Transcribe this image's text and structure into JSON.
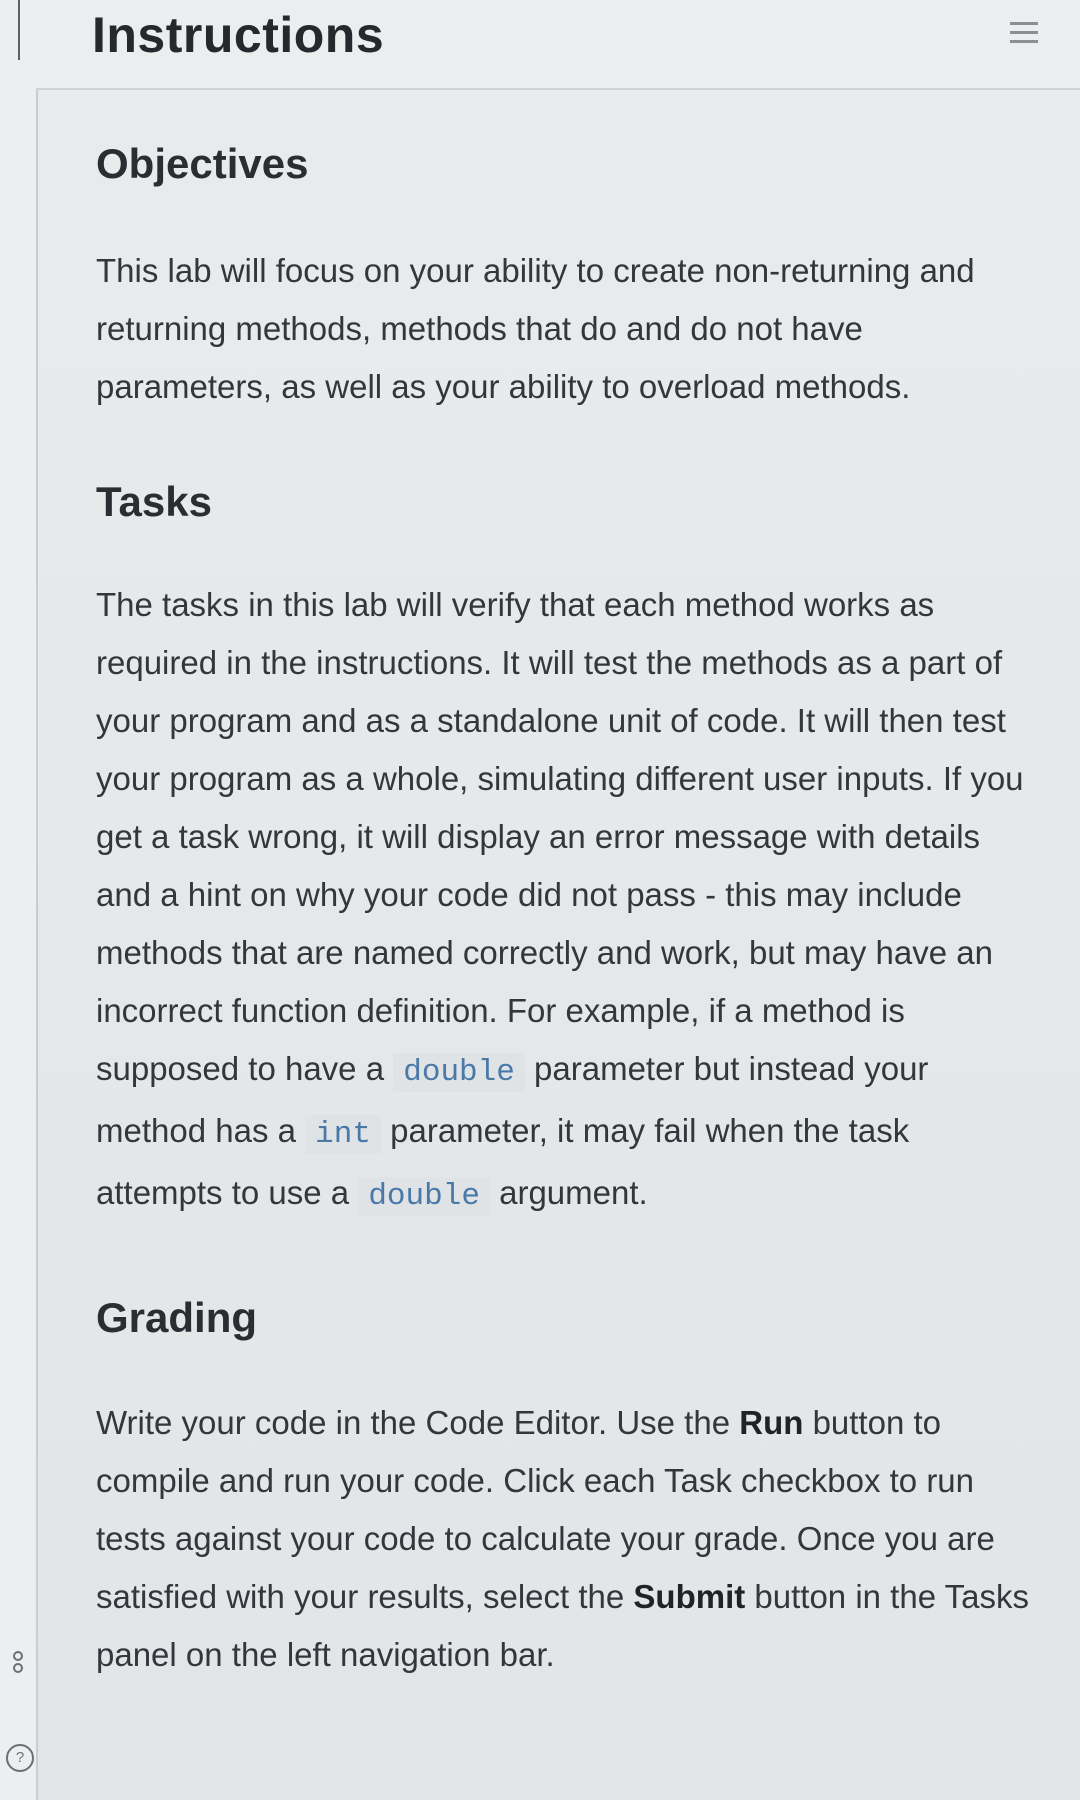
{
  "header": {
    "title": "Instructions",
    "menu_icon": "hamburger-menu-icon"
  },
  "left_rail": {
    "help_icon": "help-circle-icon",
    "help_glyph": "?",
    "people_icon": "people-icon"
  },
  "objectives": {
    "heading": "Objectives",
    "text": "This lab will focus on your ability to create non-returning and returning methods, methods that do and do not have parameters, as well as your ability to overload methods."
  },
  "tasks": {
    "heading": "Tasks",
    "text_1": "The tasks in this lab will verify that each method works as required in the instructions. It will test the methods as a part of your program and as a standalone unit of code. It will then test your program as a whole, simulating different user inputs. If you get a task wrong, it will display an error message with details and a hint on why your code did not pass - this may include methods that are named correctly and work, but may have an incorrect function definition. For example, if a method is supposed to have a",
    "code_1": "double",
    "text_2": "parameter but instead your method has a",
    "code_2": "int",
    "text_3": "parameter, it may fail when the task attempts to use a",
    "code_3": "double",
    "text_4": "argument."
  },
  "grading": {
    "heading": "Grading",
    "text_1": "Write your code in the Code Editor. Use the",
    "run_label": "Run",
    "text_2": "button to compile and run your code. Click each Task checkbox to run tests against your code to calculate your grade. Once you are satisfied with your results, select the",
    "submit_label": "Submit",
    "text_3": "button in the Tasks panel on the left navigation bar."
  }
}
